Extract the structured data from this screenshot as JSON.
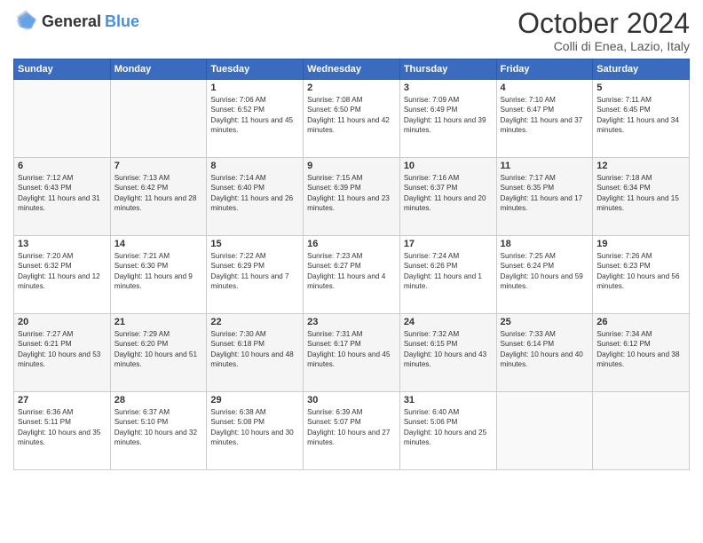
{
  "header": {
    "logo_general": "General",
    "logo_blue": "Blue",
    "month": "October 2024",
    "location": "Colli di Enea, Lazio, Italy"
  },
  "weekdays": [
    "Sunday",
    "Monday",
    "Tuesday",
    "Wednesday",
    "Thursday",
    "Friday",
    "Saturday"
  ],
  "weeks": [
    [
      {
        "day": "",
        "sunrise": "",
        "sunset": "",
        "daylight": ""
      },
      {
        "day": "",
        "sunrise": "",
        "sunset": "",
        "daylight": ""
      },
      {
        "day": "1",
        "sunrise": "Sunrise: 7:06 AM",
        "sunset": "Sunset: 6:52 PM",
        "daylight": "Daylight: 11 hours and 45 minutes."
      },
      {
        "day": "2",
        "sunrise": "Sunrise: 7:08 AM",
        "sunset": "Sunset: 6:50 PM",
        "daylight": "Daylight: 11 hours and 42 minutes."
      },
      {
        "day": "3",
        "sunrise": "Sunrise: 7:09 AM",
        "sunset": "Sunset: 6:49 PM",
        "daylight": "Daylight: 11 hours and 39 minutes."
      },
      {
        "day": "4",
        "sunrise": "Sunrise: 7:10 AM",
        "sunset": "Sunset: 6:47 PM",
        "daylight": "Daylight: 11 hours and 37 minutes."
      },
      {
        "day": "5",
        "sunrise": "Sunrise: 7:11 AM",
        "sunset": "Sunset: 6:45 PM",
        "daylight": "Daylight: 11 hours and 34 minutes."
      }
    ],
    [
      {
        "day": "6",
        "sunrise": "Sunrise: 7:12 AM",
        "sunset": "Sunset: 6:43 PM",
        "daylight": "Daylight: 11 hours and 31 minutes."
      },
      {
        "day": "7",
        "sunrise": "Sunrise: 7:13 AM",
        "sunset": "Sunset: 6:42 PM",
        "daylight": "Daylight: 11 hours and 28 minutes."
      },
      {
        "day": "8",
        "sunrise": "Sunrise: 7:14 AM",
        "sunset": "Sunset: 6:40 PM",
        "daylight": "Daylight: 11 hours and 26 minutes."
      },
      {
        "day": "9",
        "sunrise": "Sunrise: 7:15 AM",
        "sunset": "Sunset: 6:39 PM",
        "daylight": "Daylight: 11 hours and 23 minutes."
      },
      {
        "day": "10",
        "sunrise": "Sunrise: 7:16 AM",
        "sunset": "Sunset: 6:37 PM",
        "daylight": "Daylight: 11 hours and 20 minutes."
      },
      {
        "day": "11",
        "sunrise": "Sunrise: 7:17 AM",
        "sunset": "Sunset: 6:35 PM",
        "daylight": "Daylight: 11 hours and 17 minutes."
      },
      {
        "day": "12",
        "sunrise": "Sunrise: 7:18 AM",
        "sunset": "Sunset: 6:34 PM",
        "daylight": "Daylight: 11 hours and 15 minutes."
      }
    ],
    [
      {
        "day": "13",
        "sunrise": "Sunrise: 7:20 AM",
        "sunset": "Sunset: 6:32 PM",
        "daylight": "Daylight: 11 hours and 12 minutes."
      },
      {
        "day": "14",
        "sunrise": "Sunrise: 7:21 AM",
        "sunset": "Sunset: 6:30 PM",
        "daylight": "Daylight: 11 hours and 9 minutes."
      },
      {
        "day": "15",
        "sunrise": "Sunrise: 7:22 AM",
        "sunset": "Sunset: 6:29 PM",
        "daylight": "Daylight: 11 hours and 7 minutes."
      },
      {
        "day": "16",
        "sunrise": "Sunrise: 7:23 AM",
        "sunset": "Sunset: 6:27 PM",
        "daylight": "Daylight: 11 hours and 4 minutes."
      },
      {
        "day": "17",
        "sunrise": "Sunrise: 7:24 AM",
        "sunset": "Sunset: 6:26 PM",
        "daylight": "Daylight: 11 hours and 1 minute."
      },
      {
        "day": "18",
        "sunrise": "Sunrise: 7:25 AM",
        "sunset": "Sunset: 6:24 PM",
        "daylight": "Daylight: 10 hours and 59 minutes."
      },
      {
        "day": "19",
        "sunrise": "Sunrise: 7:26 AM",
        "sunset": "Sunset: 6:23 PM",
        "daylight": "Daylight: 10 hours and 56 minutes."
      }
    ],
    [
      {
        "day": "20",
        "sunrise": "Sunrise: 7:27 AM",
        "sunset": "Sunset: 6:21 PM",
        "daylight": "Daylight: 10 hours and 53 minutes."
      },
      {
        "day": "21",
        "sunrise": "Sunrise: 7:29 AM",
        "sunset": "Sunset: 6:20 PM",
        "daylight": "Daylight: 10 hours and 51 minutes."
      },
      {
        "day": "22",
        "sunrise": "Sunrise: 7:30 AM",
        "sunset": "Sunset: 6:18 PM",
        "daylight": "Daylight: 10 hours and 48 minutes."
      },
      {
        "day": "23",
        "sunrise": "Sunrise: 7:31 AM",
        "sunset": "Sunset: 6:17 PM",
        "daylight": "Daylight: 10 hours and 45 minutes."
      },
      {
        "day": "24",
        "sunrise": "Sunrise: 7:32 AM",
        "sunset": "Sunset: 6:15 PM",
        "daylight": "Daylight: 10 hours and 43 minutes."
      },
      {
        "day": "25",
        "sunrise": "Sunrise: 7:33 AM",
        "sunset": "Sunset: 6:14 PM",
        "daylight": "Daylight: 10 hours and 40 minutes."
      },
      {
        "day": "26",
        "sunrise": "Sunrise: 7:34 AM",
        "sunset": "Sunset: 6:12 PM",
        "daylight": "Daylight: 10 hours and 38 minutes."
      }
    ],
    [
      {
        "day": "27",
        "sunrise": "Sunrise: 6:36 AM",
        "sunset": "Sunset: 5:11 PM",
        "daylight": "Daylight: 10 hours and 35 minutes."
      },
      {
        "day": "28",
        "sunrise": "Sunrise: 6:37 AM",
        "sunset": "Sunset: 5:10 PM",
        "daylight": "Daylight: 10 hours and 32 minutes."
      },
      {
        "day": "29",
        "sunrise": "Sunrise: 6:38 AM",
        "sunset": "Sunset: 5:08 PM",
        "daylight": "Daylight: 10 hours and 30 minutes."
      },
      {
        "day": "30",
        "sunrise": "Sunrise: 6:39 AM",
        "sunset": "Sunset: 5:07 PM",
        "daylight": "Daylight: 10 hours and 27 minutes."
      },
      {
        "day": "31",
        "sunrise": "Sunrise: 6:40 AM",
        "sunset": "Sunset: 5:06 PM",
        "daylight": "Daylight: 10 hours and 25 minutes."
      },
      {
        "day": "",
        "sunrise": "",
        "sunset": "",
        "daylight": ""
      },
      {
        "day": "",
        "sunrise": "",
        "sunset": "",
        "daylight": ""
      }
    ]
  ]
}
